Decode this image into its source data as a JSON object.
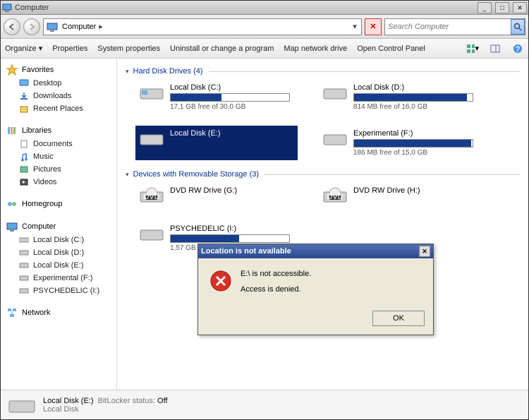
{
  "window": {
    "title": "Computer"
  },
  "address": {
    "root": "Computer"
  },
  "search": {
    "placeholder": "Search Computer"
  },
  "toolbar": {
    "organize": "Organize",
    "properties": "Properties",
    "system_properties": "System properties",
    "uninstall": "Uninstall or change a program",
    "map_drive": "Map network drive",
    "control_panel": "Open Control Panel"
  },
  "sidebar": {
    "favorites": {
      "head": "Favorites",
      "items": [
        "Desktop",
        "Downloads",
        "Recent Places"
      ]
    },
    "libraries": {
      "head": "Libraries",
      "items": [
        "Documents",
        "Music",
        "Pictures",
        "Videos"
      ]
    },
    "homegroup": {
      "head": "Homegroup"
    },
    "computer": {
      "head": "Computer",
      "items": [
        "Local Disk (C:)",
        "Local Disk (D:)",
        "Local Disk (E:)",
        "Experimental (F:)",
        "PSYCHEDELIC (I:)"
      ]
    },
    "network": {
      "head": "Network"
    }
  },
  "groups": {
    "hdd": {
      "title": "Hard Disk Drives (4)"
    },
    "removable": {
      "title": "Devices with Removable Storage (3)"
    }
  },
  "drives": {
    "c": {
      "name": "Local Disk (C:)",
      "free": "17,1 GB free of 30,0 GB",
      "pct": 43
    },
    "d": {
      "name": "Local Disk (D:)",
      "free": "814 MB free of 16,0 GB",
      "pct": 95
    },
    "e": {
      "name": "Local Disk (E:)",
      "free": ""
    },
    "f": {
      "name": "Experimental (F:)",
      "free": "186 MB free of 15,0 GB",
      "pct": 99
    },
    "g": {
      "name": "DVD RW Drive (G:)"
    },
    "h": {
      "name": "DVD RW Drive (H:)"
    },
    "i": {
      "name": "PSYCHEDELIC (I:)",
      "free": "1,57 GB free of 3,75 GB",
      "pct": 58
    }
  },
  "dialog": {
    "title": "Location is not available",
    "line1": "E:\\ is not accessible.",
    "line2": "Access is denied.",
    "ok": "OK"
  },
  "status": {
    "name": "Local Disk (E:)",
    "bitlocker_label": "BitLocker status:",
    "bitlocker_value": "Off",
    "type": "Local Disk"
  }
}
